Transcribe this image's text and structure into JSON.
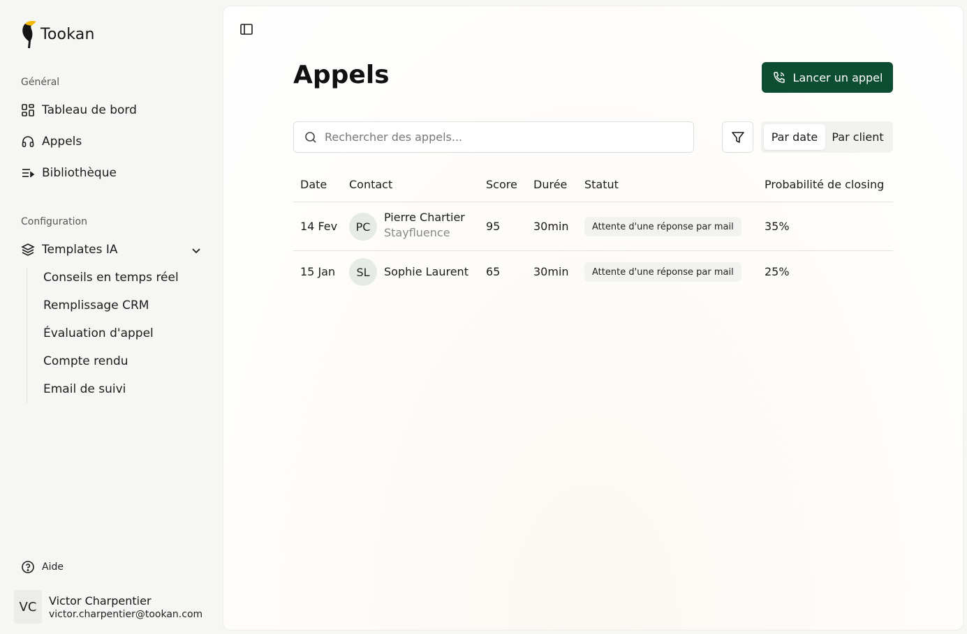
{
  "brand": {
    "name": "Tookan",
    "accent": "#0d4d31",
    "logo_accent": "#f5b800"
  },
  "sidebar": {
    "general_label": "Général",
    "general_items": [
      {
        "label": "Tableau de bord",
        "icon": "dashboard-icon"
      },
      {
        "label": "Appels",
        "icon": "headset-icon"
      },
      {
        "label": "Bibliothèque",
        "icon": "playlist-icon"
      }
    ],
    "config_label": "Configuration",
    "templates": {
      "label": "Templates IA",
      "icon": "layers-icon",
      "expanded": true,
      "children": [
        "Conseils en temps réel",
        "Remplissage CRM",
        "Évaluation d'appel",
        "Compte rendu",
        "Email de suivi"
      ]
    },
    "help_label": "Aide",
    "user": {
      "initials": "VC",
      "name": "Victor Charpentier",
      "email": "victor.charpentier@tookan.com"
    }
  },
  "main": {
    "title": "Appels",
    "cta_label": "Lancer un appel",
    "search_placeholder": "Rechercher des appels...",
    "toggle": {
      "active": "Par date",
      "inactive": "Par client"
    },
    "columns": {
      "date": "Date",
      "contact": "Contact",
      "score": "Score",
      "duration": "Durée",
      "status": "Statut",
      "probability": "Probabilité de closing"
    },
    "rows": [
      {
        "date": "14 Fev",
        "initials": "PC",
        "name": "Pierre Chartier",
        "company": "Stayfluence",
        "score": "95",
        "duration": "30min",
        "status": "Attente d'une réponse par mail",
        "probability": "35%"
      },
      {
        "date": "15 Jan",
        "initials": "SL",
        "name": "Sophie Laurent",
        "company": "",
        "score": "65",
        "duration": "30min",
        "status": "Attente d'une réponse par mail",
        "probability": "25%"
      }
    ]
  }
}
